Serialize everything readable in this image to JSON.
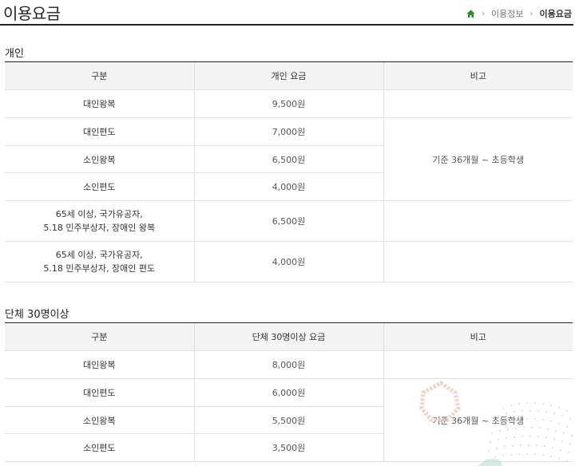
{
  "page": {
    "title": "이용요금",
    "breadcrumb": [
      "이용정보",
      "이용요금"
    ]
  },
  "individual": {
    "title": "개인",
    "headers": [
      "구분",
      "개인 요금",
      "비고"
    ],
    "rows": [
      {
        "label": "대인왕복",
        "fee": "9,500원"
      },
      {
        "label": "대인편도",
        "fee": "7,000원"
      },
      {
        "label": "소인왕복",
        "fee": "6,500원"
      },
      {
        "label": "소인편도",
        "fee": "4,000원"
      },
      {
        "label_line1": "65세 이상, 국가유공자,",
        "label_line2": "5.18 민주부상자, 장애인 왕복",
        "fee": "6,500원"
      },
      {
        "label_line1": "65세 이상, 국가유공자,",
        "label_line2": "5.18 민주부상자, 장애인 편도",
        "fee": "4,000원"
      }
    ],
    "note": "기준 36개월 ~ 초등학생"
  },
  "group": {
    "title": "단체 30명이상",
    "headers": [
      "구분",
      "단체 30명이상 요금",
      "비고"
    ],
    "rows": [
      {
        "label": "대인왕복",
        "fee": "8,000원"
      },
      {
        "label": "대인편도",
        "fee": "6,000원"
      },
      {
        "label": "소인왕복",
        "fee": "5,500원"
      },
      {
        "label": "소인편도",
        "fee": "3,500원"
      }
    ],
    "note": "기준 36개월 ~ 초등학생"
  },
  "colors": {
    "home_icon": "#2e8b2e",
    "header_rule": "#222222",
    "header_bg": "#f4f4f4"
  }
}
